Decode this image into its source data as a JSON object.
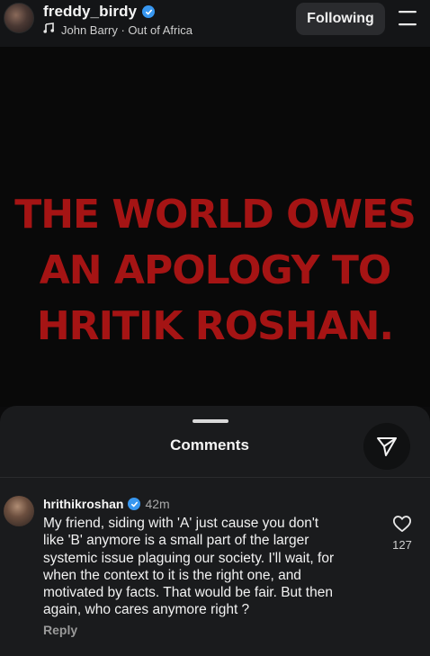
{
  "header": {
    "username": "freddy_birdy",
    "music": "John Barry · Out of Africa",
    "follow_label": "Following",
    "avatar_icon": "profile-avatar",
    "verified_icon": "verified-badge-icon",
    "music_icon": "music-note-icon",
    "menu_icon": "menu-icon"
  },
  "post": {
    "headline_lines": [
      "THE WORLD OWES",
      "AN APOLOGY TO",
      "HRITIK ROSHAN."
    ],
    "headline_color": "#a51414"
  },
  "comments": {
    "title": "Comments",
    "share_icon": "send-icon",
    "items": [
      {
        "user": "hrithikroshan",
        "time": "42m",
        "verified": true,
        "text_lines": [
          "My friend, siding with 'A' just cause you don't",
          "like 'B' anymore is a small part of the larger",
          "systemic issue plaguing our society.  I'll wait, for",
          "when the context to it is the right one, and",
          "motivated by facts. That would be fair. But then",
          "again, who cares anymore right ?"
        ],
        "reply_label": "Reply",
        "like_count": "127"
      }
    ]
  },
  "colors": {
    "accent_blue": "#3897f0",
    "sheet_background": "#1a1b1d",
    "header_background": "#141517"
  }
}
